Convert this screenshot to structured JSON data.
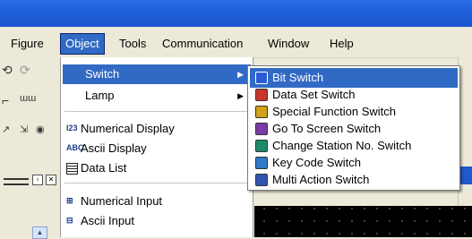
{
  "menubar": {
    "items": [
      {
        "label": "Figure"
      },
      {
        "label": "Object"
      },
      {
        "label": "Tools"
      },
      {
        "label": "Communication"
      },
      {
        "label": "Window"
      },
      {
        "label": "Help"
      }
    ],
    "active": "Object"
  },
  "object_menu": {
    "items": [
      {
        "label": "Switch",
        "icon": "none",
        "has_submenu": true
      },
      {
        "label": "Lamp",
        "icon": "none",
        "has_submenu": true
      },
      {
        "label": "Numerical Display",
        "icon": "123-icon"
      },
      {
        "label": "Ascii Display",
        "icon": "abc-icon"
      },
      {
        "label": "Data List",
        "icon": "grid-icon"
      },
      {
        "label": "Numerical Input",
        "icon": "numeric-input-icon"
      },
      {
        "label": "Ascii Input",
        "icon": "ascii-input-icon"
      }
    ],
    "highlighted": "Switch"
  },
  "switch_submenu": {
    "items": [
      {
        "label": "Bit Switch",
        "icon_color": "#2a5bd7"
      },
      {
        "label": "Data Set Switch",
        "icon_color": "#c8342b"
      },
      {
        "label": "Special Function Switch",
        "icon_color": "#d1a21a"
      },
      {
        "label": "Go To Screen Switch",
        "icon_color": "#7b3aa8"
      },
      {
        "label": "Change Station No. Switch",
        "icon_color": "#1e8a6b"
      },
      {
        "label": "Key Code Switch",
        "icon_color": "#2d7ac9"
      },
      {
        "label": "Multi Action Switch",
        "icon_color": "#2f55b0"
      }
    ],
    "highlighted": "Bit Switch"
  },
  "colors": {
    "highlight": "#316ac5",
    "titlebar": "#1f5fd8",
    "menu_background": "#ece9d8"
  }
}
